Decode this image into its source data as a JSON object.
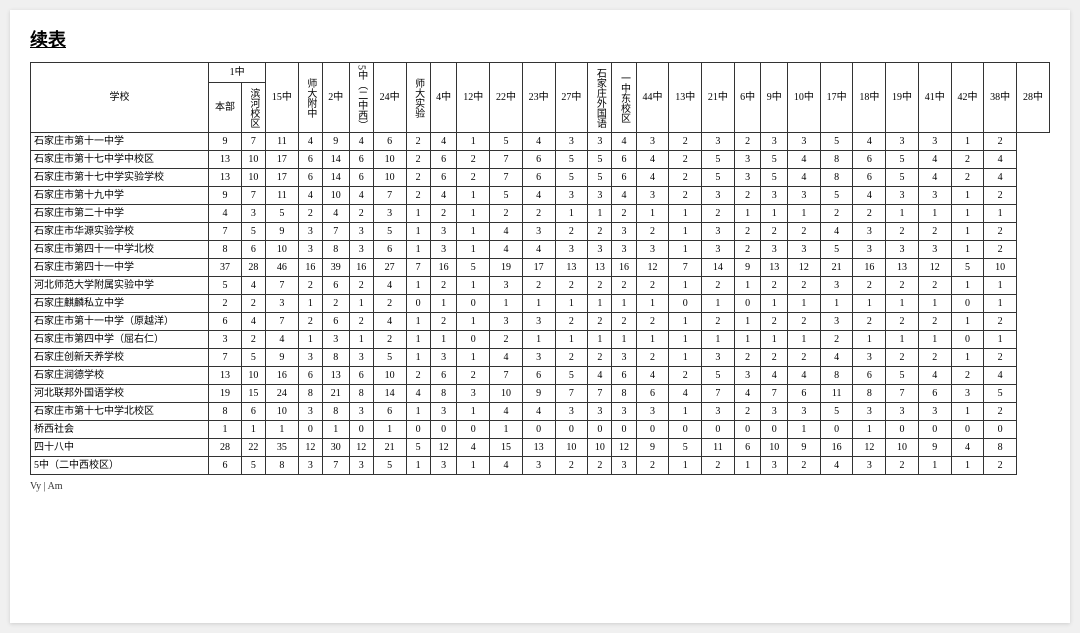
{
  "title": "续表",
  "headers": {
    "school": "学校",
    "col_groups": [
      {
        "label": "1中",
        "sub": [
          "本部",
          "滨河校区"
        ]
      },
      {
        "label": "15中",
        "sub": []
      },
      {
        "label": "师大附中",
        "sub": []
      },
      {
        "label": "2中",
        "sub": []
      },
      {
        "label": "5中（二中西）",
        "sub": []
      },
      {
        "label": "24中",
        "sub": []
      },
      {
        "label": "师大实验",
        "sub": []
      },
      {
        "label": "4中",
        "sub": []
      },
      {
        "label": "12中",
        "sub": []
      },
      {
        "label": "22中",
        "sub": []
      },
      {
        "label": "23中",
        "sub": []
      },
      {
        "label": "27中",
        "sub": []
      },
      {
        "label": "石家庄外国语",
        "sub": []
      },
      {
        "label": "一中东校区",
        "sub": []
      },
      {
        "label": "44中",
        "sub": []
      },
      {
        "label": "13中",
        "sub": []
      },
      {
        "label": "21中",
        "sub": []
      },
      {
        "label": "6中",
        "sub": []
      },
      {
        "label": "9中",
        "sub": []
      },
      {
        "label": "10中",
        "sub": []
      },
      {
        "label": "17中",
        "sub": []
      },
      {
        "label": "18中",
        "sub": []
      },
      {
        "label": "19中",
        "sub": []
      },
      {
        "label": "41中",
        "sub": []
      },
      {
        "label": "42中",
        "sub": []
      },
      {
        "label": "38中",
        "sub": []
      },
      {
        "label": "28中",
        "sub": []
      }
    ]
  },
  "rows": [
    {
      "school": "石家庄市第十一中学",
      "vals": [
        9,
        7,
        11,
        4,
        9,
        4,
        6,
        2,
        4,
        1,
        5,
        4,
        3,
        3,
        4,
        3,
        2,
        3,
        2,
        3,
        3,
        5,
        4,
        3,
        3,
        1,
        2
      ]
    },
    {
      "school": "石家庄市第十七中学中校区",
      "vals": [
        13,
        10,
        17,
        6,
        14,
        6,
        10,
        2,
        6,
        2,
        7,
        6,
        5,
        5,
        6,
        4,
        2,
        5,
        3,
        5,
        4,
        8,
        6,
        5,
        4,
        2,
        4
      ]
    },
    {
      "school": "石家庄市第十七中学实验学校",
      "vals": [
        13,
        10,
        17,
        6,
        14,
        6,
        10,
        2,
        6,
        2,
        7,
        6,
        5,
        5,
        6,
        4,
        2,
        5,
        3,
        5,
        4,
        8,
        6,
        5,
        4,
        2,
        4
      ]
    },
    {
      "school": "石家庄市第十九中学",
      "vals": [
        9,
        7,
        11,
        4,
        10,
        4,
        7,
        2,
        4,
        1,
        5,
        4,
        3,
        3,
        4,
        3,
        2,
        3,
        2,
        3,
        3,
        5,
        4,
        3,
        3,
        1,
        2
      ]
    },
    {
      "school": "石家庄市第二十中学",
      "vals": [
        4,
        3,
        5,
        2,
        4,
        2,
        3,
        1,
        2,
        1,
        2,
        2,
        1,
        1,
        2,
        1,
        1,
        2,
        1,
        1,
        1,
        2,
        2,
        1,
        1,
        1,
        1
      ]
    },
    {
      "school": "石家庄市华源实验学校",
      "vals": [
        7,
        5,
        9,
        3,
        7,
        3,
        5,
        1,
        3,
        1,
        4,
        3,
        2,
        2,
        3,
        2,
        1,
        3,
        2,
        2,
        2,
        4,
        3,
        2,
        2,
        1,
        2
      ]
    },
    {
      "school": "石家庄市第四十一中学北校",
      "vals": [
        8,
        6,
        10,
        3,
        8,
        3,
        6,
        1,
        3,
        1,
        4,
        4,
        3,
        3,
        3,
        3,
        1,
        3,
        2,
        3,
        3,
        5,
        3,
        3,
        3,
        1,
        2
      ]
    },
    {
      "school": "石家庄市第四十一中学",
      "vals": [
        37,
        28,
        46,
        16,
        39,
        16,
        27,
        7,
        16,
        5,
        19,
        17,
        13,
        13,
        16,
        12,
        7,
        14,
        9,
        13,
        12,
        21,
        16,
        13,
        12,
        5,
        10
      ]
    },
    {
      "school": "河北师范大学附属实验中学",
      "vals": [
        5,
        4,
        7,
        2,
        6,
        2,
        4,
        1,
        2,
        1,
        3,
        2,
        2,
        2,
        2,
        2,
        1,
        2,
        1,
        2,
        2,
        3,
        2,
        2,
        2,
        1,
        1
      ]
    },
    {
      "school": "石家庄麒麟私立中学",
      "vals": [
        2,
        2,
        3,
        1,
        2,
        1,
        2,
        0,
        1,
        0,
        1,
        1,
        1,
        1,
        1,
        1,
        0,
        1,
        0,
        1,
        1,
        1,
        1,
        1,
        1,
        0,
        1
      ]
    },
    {
      "school": "石家庄市第十一中学（原越洋）",
      "vals": [
        6,
        4,
        7,
        2,
        6,
        2,
        4,
        1,
        2,
        1,
        3,
        3,
        2,
        2,
        2,
        2,
        1,
        2,
        1,
        2,
        2,
        3,
        2,
        2,
        2,
        1,
        2
      ]
    },
    {
      "school": "石家庄市第四中学（屈右仁）",
      "vals": [
        3,
        2,
        4,
        1,
        3,
        1,
        2,
        1,
        1,
        0,
        2,
        1,
        1,
        1,
        1,
        1,
        1,
        1,
        1,
        1,
        1,
        2,
        1,
        1,
        1,
        0,
        1
      ]
    },
    {
      "school": "石家庄创新天养学校",
      "vals": [
        7,
        5,
        9,
        3,
        8,
        3,
        5,
        1,
        3,
        1,
        4,
        3,
        2,
        2,
        3,
        2,
        1,
        3,
        2,
        2,
        2,
        4,
        3,
        2,
        2,
        1,
        2
      ]
    },
    {
      "school": "石家庄润德学校",
      "vals": [
        13,
        10,
        16,
        6,
        13,
        6,
        10,
        2,
        6,
        2,
        7,
        6,
        5,
        4,
        6,
        4,
        2,
        5,
        3,
        4,
        4,
        8,
        6,
        5,
        4,
        2,
        4
      ]
    },
    {
      "school": "河北联邦外国语学校",
      "vals": [
        19,
        15,
        24,
        8,
        21,
        8,
        14,
        4,
        8,
        3,
        10,
        9,
        7,
        7,
        8,
        6,
        4,
        7,
        4,
        7,
        6,
        11,
        8,
        7,
        6,
        3,
        5
      ]
    },
    {
      "school": "石家庄市第十七中学北校区",
      "vals": [
        8,
        6,
        10,
        3,
        8,
        3,
        6,
        1,
        3,
        1,
        4,
        4,
        3,
        3,
        3,
        3,
        1,
        3,
        2,
        3,
        3,
        5,
        3,
        3,
        3,
        1,
        2
      ]
    },
    {
      "school": "桥西社会",
      "vals": [
        1,
        1,
        1,
        0,
        1,
        0,
        1,
        0,
        0,
        0,
        1,
        0,
        0,
        0,
        0,
        0,
        0,
        0,
        0,
        0,
        1,
        0,
        1,
        0,
        0,
        0,
        0
      ]
    },
    {
      "school": "四十八中",
      "vals": [
        28,
        22,
        35,
        12,
        30,
        12,
        21,
        5,
        12,
        4,
        15,
        13,
        10,
        10,
        12,
        9,
        5,
        11,
        6,
        10,
        9,
        16,
        12,
        10,
        9,
        4,
        8
      ]
    },
    {
      "school": "5中（二中西校区）",
      "vals": [
        6,
        5,
        8,
        3,
        7,
        3,
        5,
        1,
        3,
        1,
        4,
        3,
        2,
        2,
        3,
        2,
        1,
        2,
        1,
        3,
        2,
        4,
        3,
        2,
        1,
        1,
        2
      ]
    }
  ]
}
